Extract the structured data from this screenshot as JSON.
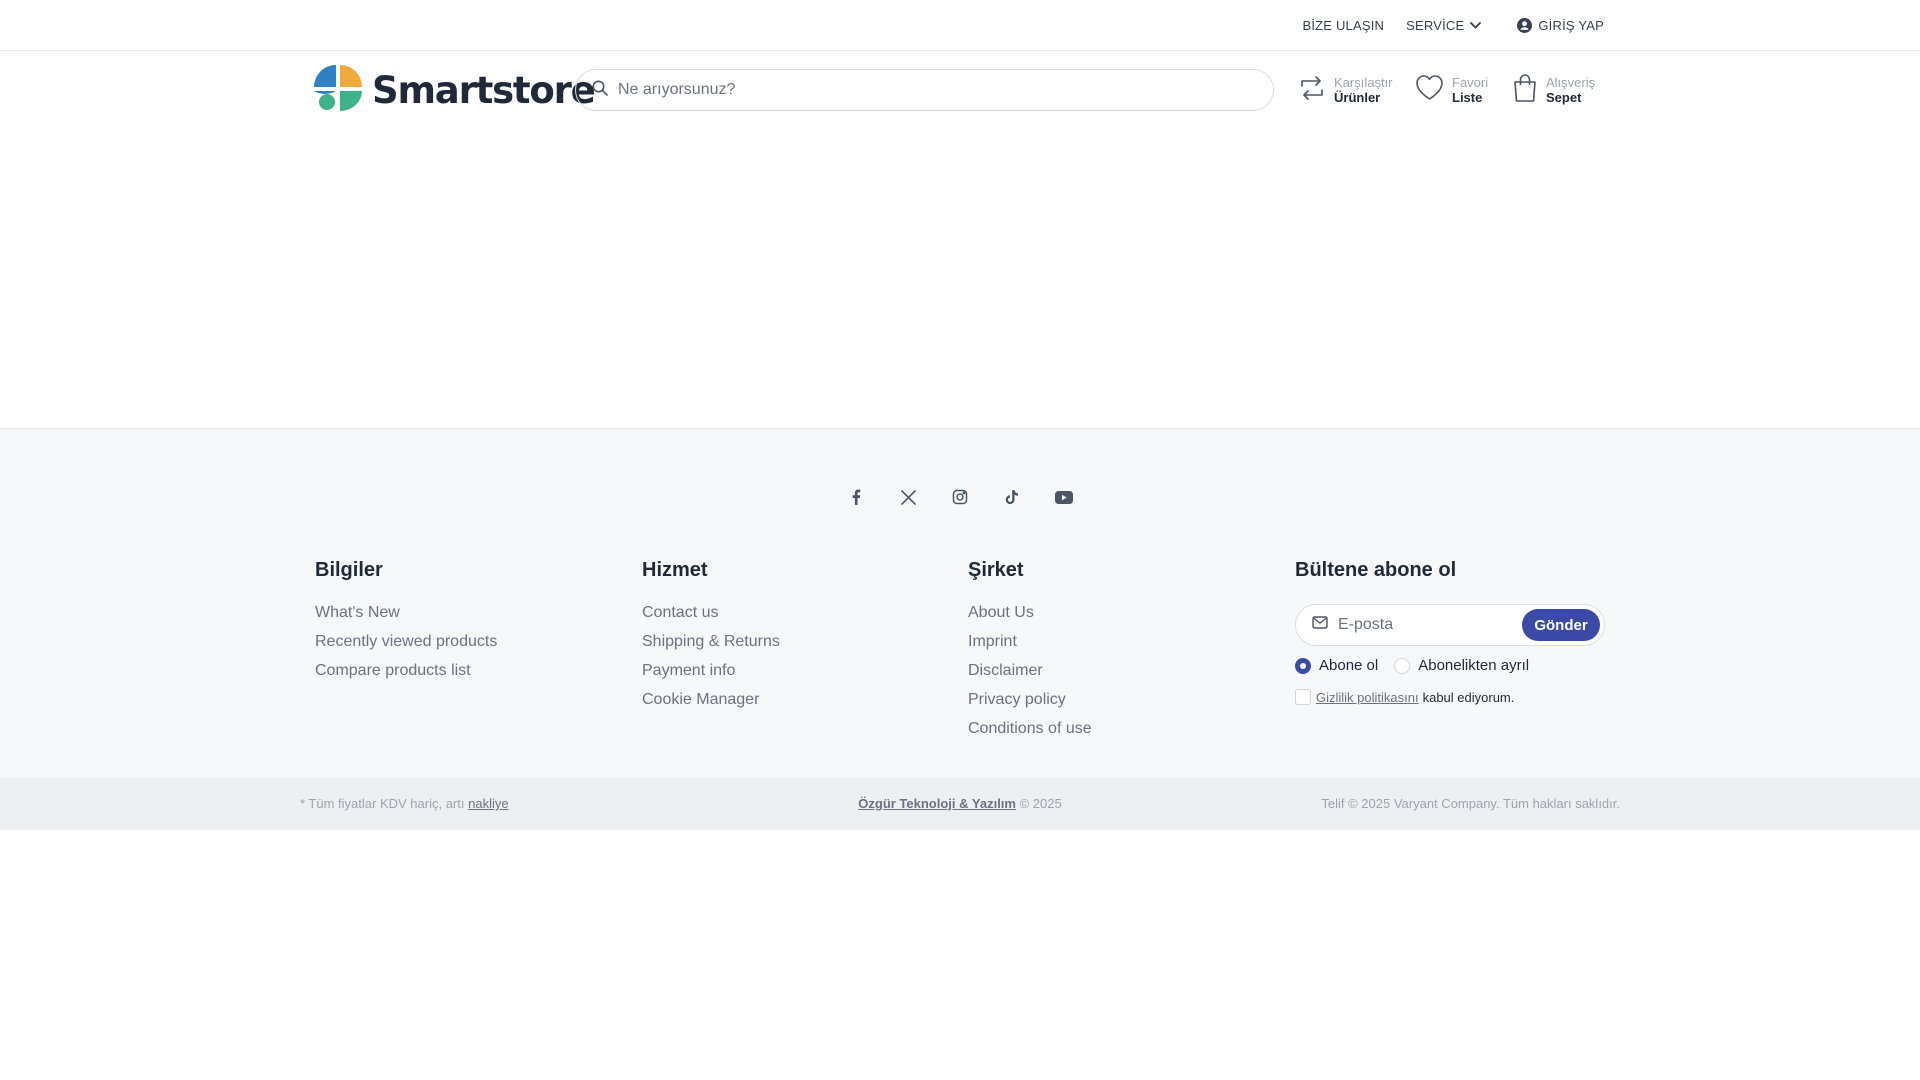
{
  "topbar": {
    "contact": "BİZE ULAŞIN",
    "service": "SERVİCE",
    "login": "GİRİŞ YAP"
  },
  "header": {
    "logo_text": "Smartstore",
    "search_placeholder": "Ne arıyorsunuz?",
    "compare": {
      "line1": "Karşılaştır",
      "line2": "Ürünler"
    },
    "wishlist": {
      "line1": "Favori",
      "line2": "Liste"
    },
    "cart": {
      "line1": "Alışveriş",
      "line2": "Sepet"
    }
  },
  "social": [
    "facebook-icon",
    "x-icon",
    "instagram-icon",
    "tiktok-icon",
    "youtube-icon"
  ],
  "footer": {
    "info": {
      "title": "Bilgiler",
      "links": [
        "What's New",
        "Recently viewed products",
        "Compare products list"
      ]
    },
    "service": {
      "title": "Hizmet",
      "links": [
        "Contact us",
        "Shipping & Returns",
        "Payment info",
        "Cookie Manager"
      ]
    },
    "company": {
      "title": "Şirket",
      "links": [
        "About Us",
        "Imprint",
        "Disclaimer",
        "Privacy policy",
        "Conditions of use"
      ]
    },
    "newsletter": {
      "title": "Bültene abone ol",
      "email_placeholder": "E-posta",
      "submit": "Gönder",
      "subscribe": "Abone ol",
      "unsubscribe": "Abonelikten ayrıl",
      "privacy_link": "Gizlilik politikasını",
      "privacy_suffix": "kabul ediyorum."
    }
  },
  "bottombar": {
    "vat_prefix": "* Tüm fiyatlar KDV hariç, artı",
    "vat_link": "nakliye",
    "company_link": "Özgür Teknoloji & Yazılım",
    "year_suffix": "© 2025",
    "copyright": "Telif © 2025 Varyant Company. Tüm hakları saklıdır."
  },
  "colors": {
    "accent": "#3a4aa6",
    "logo_blue": "#2f80c4",
    "logo_orange": "#f2a93b",
    "logo_green": "#3cb38a"
  }
}
